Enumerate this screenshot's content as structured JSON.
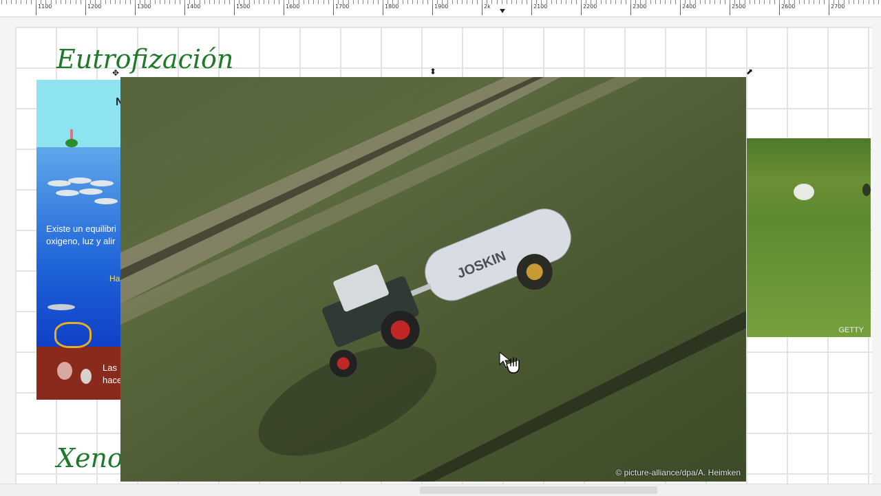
{
  "ruler": {
    "labels": [
      "1100",
      "1200",
      "1300",
      "1400",
      "1500",
      "1600",
      "1700",
      "1800",
      "1900",
      "2k",
      "2100",
      "2200",
      "2300",
      "2400",
      "2500",
      "2600",
      "2700"
    ]
  },
  "slide": {
    "title_top": "Eutrofización",
    "title_bottom": "Xenob"
  },
  "left_image": {
    "heading_fragment": "N",
    "text_line1": "Existe un equilibri",
    "text_line2": "oxigeno, luz y alir",
    "label_mid": "Ha",
    "bottom_line1": "Las",
    "bottom_line2": "hace"
  },
  "main_image": {
    "tank_brand": "JOSKIN",
    "credit": "© picture-alliance/dpa/A. Heimken"
  },
  "right_image": {
    "credit": "GETTY"
  },
  "colors": {
    "title_green": "#1e7a2a",
    "ruler_bg": "#ffffff",
    "grid_line": "#e3e3e3"
  }
}
